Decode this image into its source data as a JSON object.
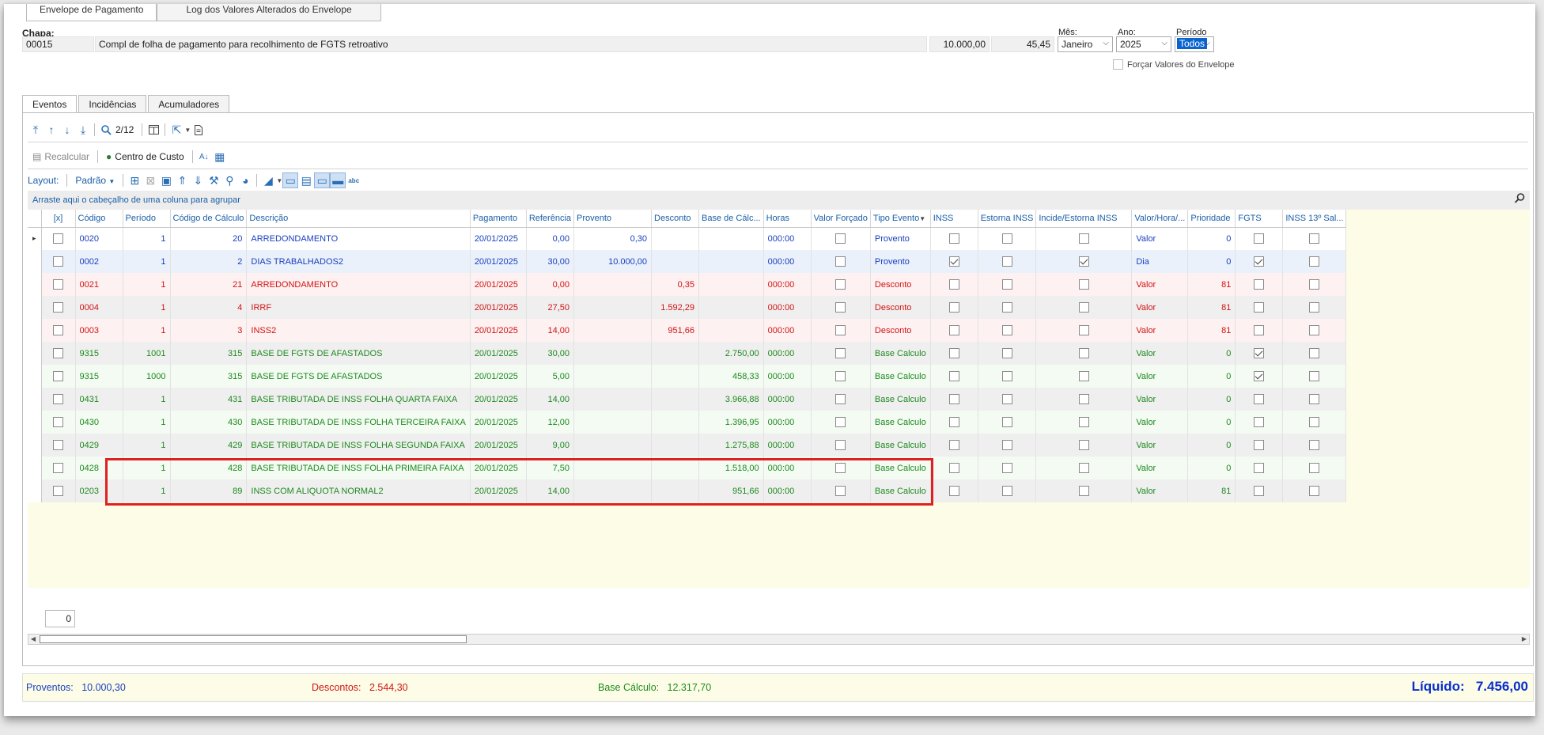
{
  "top_tabs": [
    "Envelope de Pagamento",
    "Log dos Valores Alterados do Envelope"
  ],
  "header": {
    "chapa_label": "Chapa:",
    "chapa_code": "00015",
    "chapa_desc": "Compl de folha de pagamento para recolhimento de FGTS retroativo",
    "value1": "10.000,00",
    "value2": "45,45",
    "mes_label": "Mês:",
    "mes_value": "Janeiro",
    "ano_label": "Ano:",
    "ano_value": "2025",
    "periodo_label": "Período",
    "periodo_value": "Todos",
    "forcar_label": "Forçar Valores do Envelope"
  },
  "inner_tabs": [
    "Eventos",
    "Incidências",
    "Acumuladores"
  ],
  "toolbar": {
    "page": "2/12",
    "recalcular": "Recalcular",
    "centro_custo": "Centro de Custo",
    "layout_label": "Layout:",
    "layout_value": "Padrão"
  },
  "group_hint": "Arraste aqui o cabeçalho de uma coluna para agrupar",
  "columns": [
    "[x]",
    "Código",
    "Período",
    "Código de Cálculo",
    "Descrição",
    "Pagamento",
    "Referência",
    "Provento",
    "Desconto",
    "Base de Cálc...",
    "Horas",
    "Valor Forçado",
    "Tipo Evento",
    "INSS",
    "Estorna INSS",
    "Incide/Estorna INSS",
    "Valor/Hora/...",
    "Prioridade",
    "FGTS",
    "INSS 13º Sal..."
  ],
  "rows": [
    {
      "color": "blue",
      "codigo": "0020",
      "periodo": "1",
      "calc": "20",
      "desc": "ARREDONDAMENTO",
      "pag": "20/01/2025",
      "ref": "0,00",
      "prov": "0,30",
      "desc_val": "",
      "base": "",
      "horas": "000:00",
      "tipo": "Provento",
      "inss": false,
      "incide": false,
      "vh": "Valor",
      "prio": "0",
      "fgts": false
    },
    {
      "color": "blue",
      "codigo": "0002",
      "periodo": "1",
      "calc": "2",
      "desc": "DIAS TRABALHADOS2",
      "pag": "20/01/2025",
      "ref": "30,00",
      "prov": "10.000,00",
      "desc_val": "",
      "base": "",
      "horas": "000:00",
      "tipo": "Provento",
      "inss": true,
      "incide": true,
      "vh": "Dia",
      "prio": "0",
      "fgts": true
    },
    {
      "color": "red",
      "codigo": "0021",
      "periodo": "1",
      "calc": "21",
      "desc": "ARREDONDAMENTO",
      "pag": "20/01/2025",
      "ref": "0,00",
      "prov": "",
      "desc_val": "0,35",
      "base": "",
      "horas": "000:00",
      "tipo": "Desconto",
      "inss": false,
      "incide": false,
      "vh": "Valor",
      "prio": "81",
      "fgts": false
    },
    {
      "color": "red",
      "codigo": "0004",
      "periodo": "1",
      "calc": "4",
      "desc": "IRRF",
      "pag": "20/01/2025",
      "ref": "27,50",
      "prov": "",
      "desc_val": "1.592,29",
      "base": "",
      "horas": "000:00",
      "tipo": "Desconto",
      "inss": false,
      "incide": false,
      "vh": "Valor",
      "prio": "81",
      "fgts": false
    },
    {
      "color": "red",
      "codigo": "0003",
      "periodo": "1",
      "calc": "3",
      "desc": "INSS2",
      "pag": "20/01/2025",
      "ref": "14,00",
      "prov": "",
      "desc_val": "951,66",
      "base": "",
      "horas": "000:00",
      "tipo": "Desconto",
      "inss": false,
      "incide": false,
      "vh": "Valor",
      "prio": "81",
      "fgts": false
    },
    {
      "color": "green",
      "codigo": "9315",
      "periodo": "1001",
      "calc": "315",
      "desc": "BASE DE FGTS DE AFASTADOS",
      "pag": "20/01/2025",
      "ref": "30,00",
      "prov": "",
      "desc_val": "",
      "base": "2.750,00",
      "horas": "000:00",
      "tipo": "Base Calculo",
      "inss": false,
      "incide": false,
      "vh": "Valor",
      "prio": "0",
      "fgts": true
    },
    {
      "color": "green",
      "codigo": "9315",
      "periodo": "1000",
      "calc": "315",
      "desc": "BASE DE FGTS DE AFASTADOS",
      "pag": "20/01/2025",
      "ref": "5,00",
      "prov": "",
      "desc_val": "",
      "base": "458,33",
      "horas": "000:00",
      "tipo": "Base Calculo",
      "inss": false,
      "incide": false,
      "vh": "Valor",
      "prio": "0",
      "fgts": true
    },
    {
      "color": "green",
      "codigo": "0431",
      "periodo": "1",
      "calc": "431",
      "desc": "BASE TRIBUTADA DE INSS FOLHA QUARTA FAIXA",
      "pag": "20/01/2025",
      "ref": "14,00",
      "prov": "",
      "desc_val": "",
      "base": "3.966,88",
      "horas": "000:00",
      "tipo": "Base Calculo",
      "inss": false,
      "incide": false,
      "vh": "Valor",
      "prio": "0",
      "fgts": false
    },
    {
      "color": "green",
      "codigo": "0430",
      "periodo": "1",
      "calc": "430",
      "desc": "BASE TRIBUTADA DE INSS FOLHA TERCEIRA FAIXA",
      "pag": "20/01/2025",
      "ref": "12,00",
      "prov": "",
      "desc_val": "",
      "base": "1.396,95",
      "horas": "000:00",
      "tipo": "Base Calculo",
      "inss": false,
      "incide": false,
      "vh": "Valor",
      "prio": "0",
      "fgts": false
    },
    {
      "color": "green",
      "codigo": "0429",
      "periodo": "1",
      "calc": "429",
      "desc": "BASE TRIBUTADA DE INSS FOLHA SEGUNDA FAIXA",
      "pag": "20/01/2025",
      "ref": "9,00",
      "prov": "",
      "desc_val": "",
      "base": "1.275,88",
      "horas": "000:00",
      "tipo": "Base Calculo",
      "inss": false,
      "incide": false,
      "vh": "Valor",
      "prio": "0",
      "fgts": false
    },
    {
      "color": "green",
      "codigo": "0428",
      "periodo": "1",
      "calc": "428",
      "desc": "BASE TRIBUTADA DE INSS FOLHA PRIMEIRA FAIXA",
      "pag": "20/01/2025",
      "ref": "7,50",
      "prov": "",
      "desc_val": "",
      "base": "1.518,00",
      "horas": "000:00",
      "tipo": "Base Calculo",
      "inss": false,
      "incide": false,
      "vh": "Valor",
      "prio": "0",
      "fgts": false
    },
    {
      "color": "green",
      "codigo": "0203",
      "periodo": "1",
      "calc": "89",
      "desc": "INSS COM ALIQUOTA NORMAL2",
      "pag": "20/01/2025",
      "ref": "14,00",
      "prov": "",
      "desc_val": "",
      "base": "951,66",
      "horas": "000:00",
      "tipo": "Base Calculo",
      "inss": false,
      "incide": false,
      "vh": "Valor",
      "prio": "81",
      "fgts": false
    }
  ],
  "pager_value": "0",
  "totals": {
    "proventos_label": "Proventos:",
    "proventos_value": "10.000,30",
    "descontos_label": "Descontos:",
    "descontos_value": "2.544,30",
    "base_label": "Base Cálculo:",
    "base_value": "12.317,70",
    "liquido_label": "Líquido:",
    "liquido_value": "7.456,00"
  },
  "colors": {
    "provento": "#1a3fbf",
    "desconto": "#d31313",
    "base": "#1e8a1e",
    "highlight": "#e02020"
  }
}
